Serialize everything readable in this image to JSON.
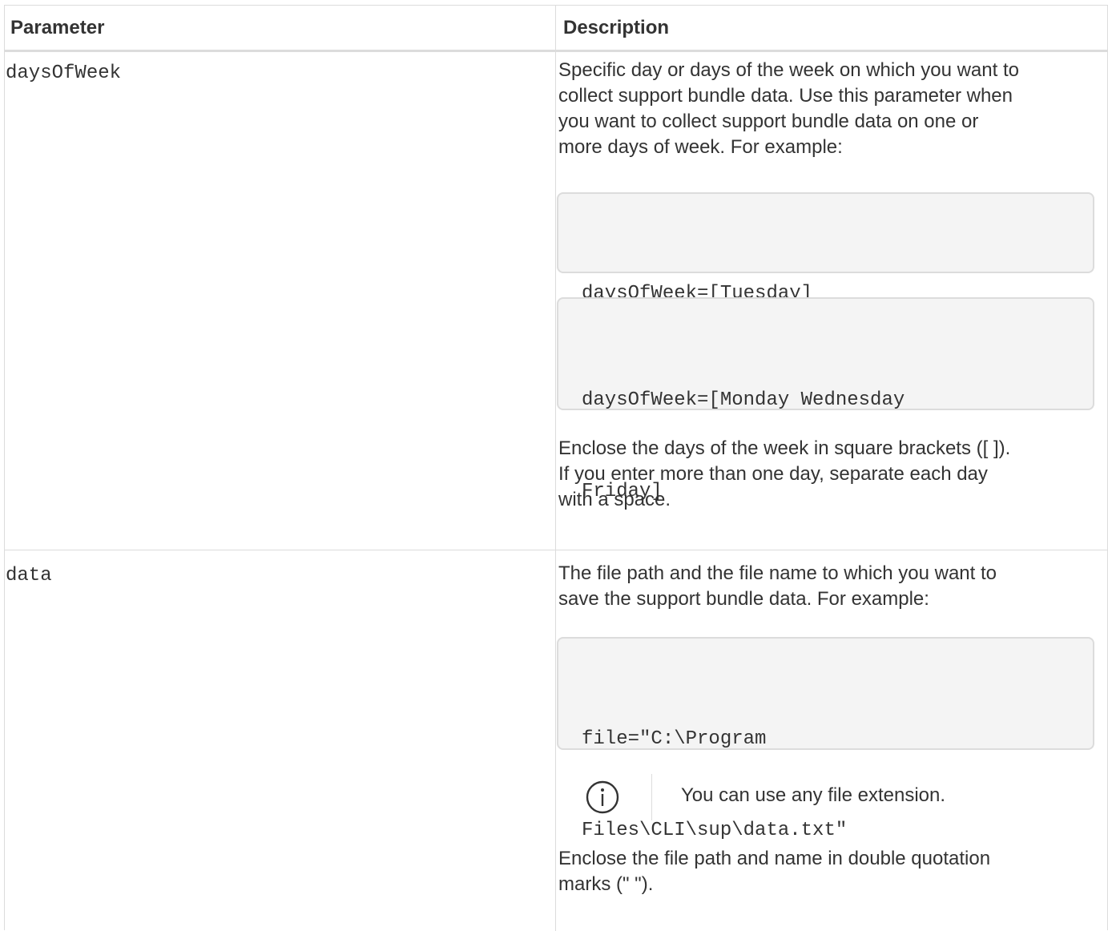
{
  "table": {
    "headers": {
      "parameter": "Parameter",
      "description": "Description"
    },
    "rows": [
      {
        "parameter": "daysOfWeek",
        "description_lines": [
          "Specific day or days of the week on which you want to",
          "collect support bundle data. Use this parameter when",
          "you want to collect support bundle data on one or",
          "more days of week. For example:"
        ],
        "code_examples": [
          [
            "daysOfWeek=[Tuesday]"
          ],
          [
            "daysOfWeek=[Monday Wednesday",
            "Friday]"
          ]
        ],
        "after_lines": [
          "Enclose the days of the week in square brackets ([ ]).",
          "If you enter more than one day, separate each day",
          "with a space."
        ]
      },
      {
        "parameter": "data",
        "description_lines": [
          "The file path and the file name to which you want to",
          "save the support bundle data. For example:"
        ],
        "code_examples": [
          [
            "file=\"C:\\Program",
            "Files\\CLI\\sup\\data.txt\""
          ]
        ],
        "note": {
          "icon": "info-icon",
          "text": "You can use any file extension."
        },
        "after_lines": [
          "Enclose the file path and name in double quotation",
          "marks (\" \")."
        ]
      }
    ]
  }
}
